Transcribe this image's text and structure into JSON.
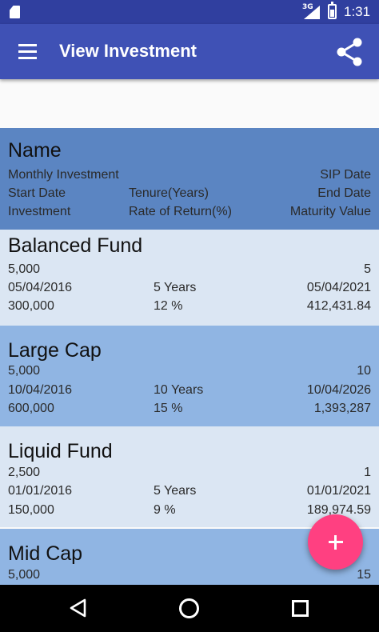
{
  "status_bar": {
    "network_type": "3G",
    "time": "1:31",
    "icons": [
      "sd-card-icon",
      "cell-signal-icon",
      "battery-icon"
    ]
  },
  "app_bar": {
    "title": "View Investment",
    "menu_icon": "hamburger-menu-icon",
    "share_icon": "share-icon",
    "color": "#3f51b5"
  },
  "header": {
    "name": "Name",
    "line1": [
      "Monthly Investment",
      "",
      "SIP Date"
    ],
    "line2": [
      "Start Date",
      "Tenure(Years)",
      "End Date"
    ],
    "line3": [
      "Investment",
      "Rate of Return(%)",
      "Maturity Value"
    ]
  },
  "investments": [
    {
      "name": "Balanced Fund",
      "monthly": "5,000",
      "sip_date": "5",
      "start": "05/04/2016",
      "tenure": "5 Years",
      "end": "05/04/2021",
      "invested": "300,000",
      "rate": "12 %",
      "maturity": "412,431.84"
    },
    {
      "name": "Large Cap",
      "monthly": "5,000",
      "sip_date": "10",
      "start": "10/04/2016",
      "tenure": "10 Years",
      "end": "10/04/2026",
      "invested": "600,000",
      "rate": "15 %",
      "maturity": "1,393,287"
    },
    {
      "name": "Liquid Fund",
      "monthly": "2,500",
      "sip_date": "1",
      "start": "01/01/2016",
      "tenure": "5 Years",
      "end": "01/01/2021",
      "invested": "150,000",
      "rate": "9 %",
      "maturity": "189,974.59"
    },
    {
      "name": "Mid Cap",
      "monthly": "5,000",
      "sip_date": "15"
    }
  ],
  "fab": {
    "icon": "plus-icon",
    "color": "#ff4081"
  },
  "nav_bar": {
    "icons": [
      "back-triangle-icon",
      "home-circle-icon",
      "recents-square-icon"
    ]
  }
}
